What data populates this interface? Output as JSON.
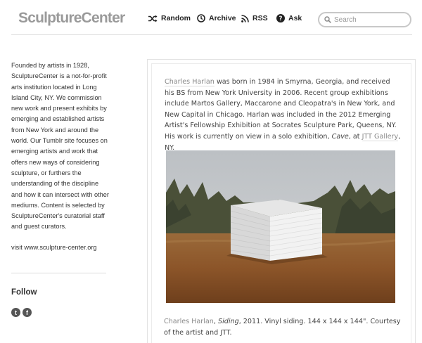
{
  "header": {
    "logo": "SculptureCenter",
    "nav": [
      {
        "label": "Random",
        "icon": "shuffle-icon"
      },
      {
        "label": "Archive",
        "icon": "clock-icon"
      },
      {
        "label": "RSS",
        "icon": "rss-icon"
      },
      {
        "label": "Ask",
        "icon": "question-icon"
      }
    ],
    "search_placeholder": "Search"
  },
  "sidebar": {
    "about": "Founded by artists in 1928, SculptureCenter is a not-for-profit arts institution located in Long Island City, NY. We commission new work and present exhibits by emerging and established artists from New York and around the world. Our Tumblr site focuses on emerging artists and work that offers new ways of considering sculpture, or furthers the understanding of the discipline and how it can intersect with other mediums. Content is selected by SculptureCenter's curatorial staff and guest curators.",
    "visit_text": "visit www.sculpture-center.org",
    "follow_title": "Follow",
    "social": [
      {
        "name": "twitter-icon",
        "glyph": "t"
      },
      {
        "name": "facebook-icon",
        "glyph": "f"
      }
    ]
  },
  "post": {
    "artist_link": "Charles Harlan",
    "body_a": " was born in 1984 in Smyrna, Georgia, and received his BS from New York University in 2006. Recent group exhibitions include Martos Gallery, Maccarone and Cleopatra's in New York, and New Capital in Chicago. Harlan was included in the 2012 Emerging Artist's Fellowship Exhibition at Socrates Sculpture Park, Queens, NY. His work is currently on view in a solo exhibition, ",
    "body_work": "Cave",
    "body_b": ", at ",
    "gallery_link": "JTT Gallery",
    "body_c": ", NY.",
    "caption_artist": "Charles Harlan",
    "caption_sep": ", ",
    "caption_title": "Siding",
    "caption_rest": ", 2011.  Vinyl siding.  144 x 144 x 144\".  Courtesy of the artist and JTT."
  },
  "colors": {
    "logo": "#9a9a9a",
    "link": "#888888",
    "rule": "#dcdcdc"
  }
}
